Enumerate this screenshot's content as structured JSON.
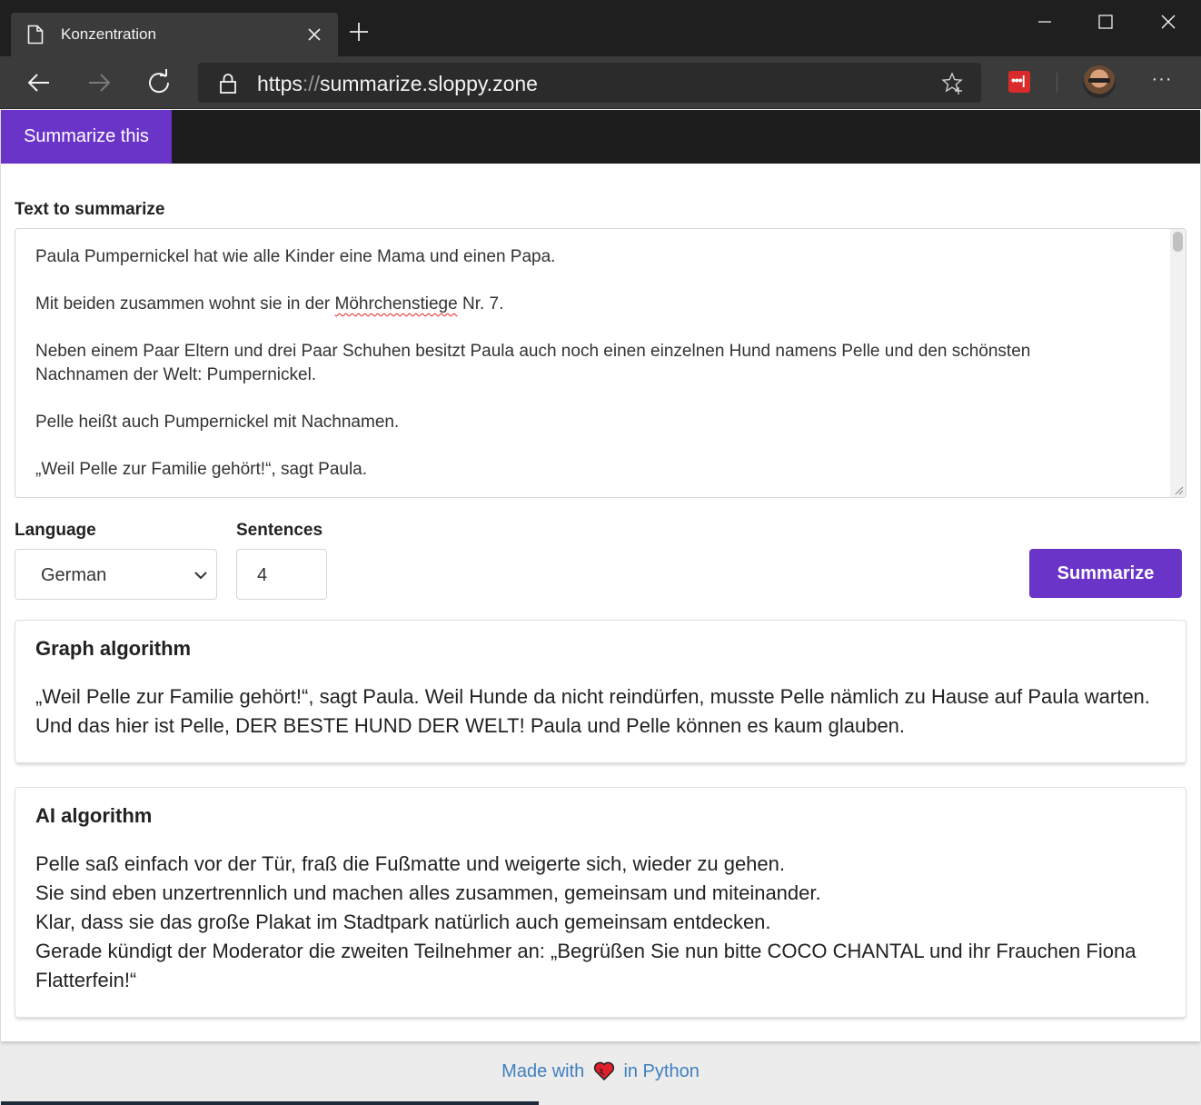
{
  "browser": {
    "tab_title": "Konzentration",
    "url_scheme": "https",
    "url_separator": "://",
    "url_host": "summarize.sloppy.zone",
    "icons": {
      "page": "page-icon",
      "close_tab": "close-icon",
      "new_tab": "plus-icon",
      "back": "arrow-left-icon",
      "forward": "arrow-right-icon",
      "reload": "reload-icon",
      "lock": "lock-icon",
      "favorite": "star-plus-icon",
      "extension": "lastpass-icon",
      "profile": "avatar",
      "menu": "more-icon"
    }
  },
  "nav": {
    "brand": "Summarize this"
  },
  "form": {
    "text_label": "Text to summarize",
    "text_lines": [
      "Paula Pumpernickel hat wie alle Kinder eine Mama und einen Papa.",
      "Neben einem Paar Eltern und drei Paar Schuhen besitzt Paula auch noch einen einzelnen Hund namens Pelle und den schönsten",
      "Nachnamen der Welt: Pumpernickel.",
      "Pelle heißt auch Pumpernickel mit Nachnamen.",
      "„Weil Pelle zur Familie gehört!“, sagt Paula."
    ],
    "line2_before": "Mit beiden zusammen wohnt sie in der ",
    "line2_misspelled": "Möhrchenstiege",
    "line2_after": " Nr. 7.",
    "language_label": "Language",
    "language_value": "German",
    "sentences_label": "Sentences",
    "sentences_value": "4",
    "submit_label": "Summarize"
  },
  "results": {
    "graph": {
      "title": "Graph algorithm",
      "lines": [
        "„Weil Pelle zur Familie gehört!“, sagt Paula. Weil Hunde da nicht reindürfen, musste Pelle nämlich zu Hause auf Paula warten.",
        "Und das hier ist Pelle, DER BESTE HUND DER WELT! Paula und Pelle können es kaum glauben."
      ]
    },
    "ai": {
      "title": "AI algorithm",
      "lines": [
        "Pelle saß einfach vor der Tür, fraß die Fußmatte und weigerte sich, wieder zu gehen.",
        "Sie sind eben unzertrennlich und machen alles zusammen, gemeinsam und miteinander.",
        "Klar, dass sie das große Plakat im Stadtpark natürlich auch gemeinsam entdecken.",
        "Gerade kündigt der Moderator die zweiten Teilnehmer an: „Begrüßen Sie nun bitte COCO CHANTAL und ihr Frauchen Fiona",
        "Flatterfein!“"
      ]
    }
  },
  "footer": {
    "made_with": "Made with",
    "in_python": "in Python",
    "heart_icon": "heart-icon"
  },
  "colors": {
    "brand": "#6a34c9",
    "link": "#3f7fbf",
    "navbar": "#1d1d1d"
  }
}
